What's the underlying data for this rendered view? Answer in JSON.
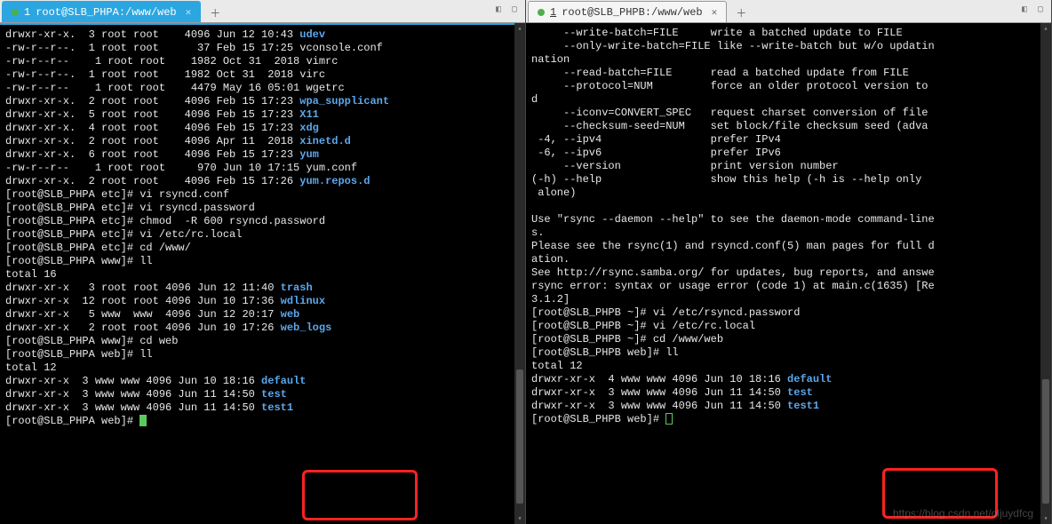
{
  "left": {
    "tab_number": "1",
    "tab_title": "root@SLB_PHPA:/www/web",
    "lines": [
      {
        "perm": "drwxr-xr-x.",
        "n": "3",
        "o": "root",
        "g": "root",
        "sz": "   4096",
        "date": "Jun 12 10:43",
        "name": "udev",
        "dir": true
      },
      {
        "perm": "-rw-r--r--.",
        "n": "1",
        "o": "root",
        "g": "root",
        "sz": "     37",
        "date": "Feb 15 17:25",
        "name": "vconsole.conf"
      },
      {
        "perm": "-rw-r--r--",
        "n": "  1",
        "o": "root",
        "g": "root",
        "sz": "   1982",
        "date": "Oct 31  2018",
        "name": "vimrc"
      },
      {
        "perm": "-rw-r--r--.",
        "n": "1",
        "o": "root",
        "g": "root",
        "sz": "   1982",
        "date": "Oct 31  2018",
        "name": "virc"
      },
      {
        "perm": "-rw-r--r--",
        "n": "  1",
        "o": "root",
        "g": "root",
        "sz": "   4479",
        "date": "May 16 05:01",
        "name": "wgetrc"
      },
      {
        "perm": "drwxr-xr-x.",
        "n": "2",
        "o": "root",
        "g": "root",
        "sz": "   4096",
        "date": "Feb 15 17:23",
        "name": "wpa_supplicant",
        "dir": true
      },
      {
        "perm": "drwxr-xr-x.",
        "n": "5",
        "o": "root",
        "g": "root",
        "sz": "   4096",
        "date": "Feb 15 17:23",
        "name": "X11",
        "dir": true
      },
      {
        "perm": "drwxr-xr-x.",
        "n": "4",
        "o": "root",
        "g": "root",
        "sz": "   4096",
        "date": "Feb 15 17:23",
        "name": "xdg",
        "dir": true
      },
      {
        "perm": "drwxr-xr-x.",
        "n": "2",
        "o": "root",
        "g": "root",
        "sz": "   4096",
        "date": "Apr 11  2018",
        "name": "xinetd.d",
        "dir": true
      },
      {
        "perm": "drwxr-xr-x.",
        "n": "6",
        "o": "root",
        "g": "root",
        "sz": "   4096",
        "date": "Feb 15 17:23",
        "name": "yum",
        "dir": true
      },
      {
        "perm": "-rw-r--r--",
        "n": "  1",
        "o": "root",
        "g": "root",
        "sz": "    970",
        "date": "Jun 10 17:15",
        "name": "yum.conf"
      },
      {
        "perm": "drwxr-xr-x.",
        "n": "2",
        "o": "root",
        "g": "root",
        "sz": "   4096",
        "date": "Feb 15 17:26",
        "name": "yum.repos.d",
        "dir": true
      }
    ],
    "cmds": [
      {
        "p": "[root@SLB_PHPA etc]#",
        "c": "vi rsyncd.conf"
      },
      {
        "p": "[root@SLB_PHPA etc]#",
        "c": "vi rsyncd.password"
      },
      {
        "p": "[root@SLB_PHPA etc]#",
        "c": "chmod  -R 600 rsyncd.password"
      },
      {
        "p": "[root@SLB_PHPA etc]#",
        "c": "vi /etc/rc.local"
      },
      {
        "p": "[root@SLB_PHPA etc]#",
        "c": "cd /www/"
      },
      {
        "p": "[root@SLB_PHPA www]#",
        "c": "ll"
      }
    ],
    "total1": "total 16",
    "lines2": [
      {
        "perm": "drwxr-xr-x",
        "n": " 3",
        "o": "root",
        "g": "root",
        "sz": "4096",
        "date": "Jun 12 11:40",
        "name": "trash",
        "dir": true
      },
      {
        "perm": "drwxr-xr-x",
        "n": "12",
        "o": "root",
        "g": "root",
        "sz": "4096",
        "date": "Jun 10 17:36",
        "name": "wdlinux",
        "dir": true
      },
      {
        "perm": "drwxr-xr-x",
        "n": " 5",
        "o": "www ",
        "g": "www ",
        "sz": "4096",
        "date": "Jun 12 20:17",
        "name": "web",
        "dir": true
      },
      {
        "perm": "drwxr-xr-x",
        "n": " 2",
        "o": "root",
        "g": "root",
        "sz": "4096",
        "date": "Jun 10 17:26",
        "name": "web_logs",
        "dir": true
      }
    ],
    "cmds2": [
      {
        "p": "[root@SLB_PHPA www]#",
        "c": "cd web"
      },
      {
        "p": "[root@SLB_PHPA web]#",
        "c": "ll"
      }
    ],
    "total2": "total 12",
    "lines3": [
      {
        "perm": "drwxr-xr-x",
        "n": "3",
        "o": "www",
        "g": "www",
        "sz": "4096",
        "date": "Jun 10 18:16",
        "name": "default",
        "dir": true
      },
      {
        "perm": "drwxr-xr-x",
        "n": "3",
        "o": "www",
        "g": "www",
        "sz": "4096",
        "date": "Jun 11 14:50",
        "name": "test",
        "dir": true
      },
      {
        "perm": "drwxr-xr-x",
        "n": "3",
        "o": "www",
        "g": "www",
        "sz": "4096",
        "date": "Jun 11 14:50",
        "name": "test1",
        "dir": true
      }
    ],
    "prompt_final": "[root@SLB_PHPA web]# "
  },
  "right": {
    "tab_number": "1",
    "tab_title": "root@SLB_PHPB:/www/web",
    "help": [
      "     --write-batch=FILE     write a batched update to FILE",
      "     --only-write-batch=FILE like --write-batch but w/o updatin",
      "nation",
      "     --read-batch=FILE      read a batched update from FILE",
      "     --protocol=NUM         force an older protocol version to",
      "d",
      "     --iconv=CONVERT_SPEC   request charset conversion of file",
      "     --checksum-seed=NUM    set block/file checksum seed (adva",
      " -4, --ipv4                 prefer IPv4",
      " -6, --ipv6                 prefer IPv6",
      "     --version              print version number",
      "(-h) --help                 show this help (-h is --help only ",
      " alone)",
      "",
      "Use \"rsync --daemon --help\" to see the daemon-mode command-line",
      "s.",
      "Please see the rsync(1) and rsyncd.conf(5) man pages for full d",
      "ation.",
      "See http://rsync.samba.org/ for updates, bug reports, and answe",
      "rsync error: syntax or usage error (code 1) at main.c(1635) [Re",
      "3.1.2]"
    ],
    "cmds": [
      {
        "p": "[root@SLB_PHPB ~]#",
        "c": "vi /etc/rsyncd.password"
      },
      {
        "p": "[root@SLB_PHPB ~]#",
        "c": "vi /etc/rc.local"
      },
      {
        "p": "[root@SLB_PHPB ~]#",
        "c": "cd /www/web"
      },
      {
        "p": "[root@SLB_PHPB web]#",
        "c": "ll"
      }
    ],
    "total": "total 12",
    "lines": [
      {
        "perm": "drwxr-xr-x",
        "n": "4",
        "o": "www",
        "g": "www",
        "sz": "4096",
        "date": "Jun 10 18:16",
        "name": "default",
        "dir": true
      },
      {
        "perm": "drwxr-xr-x",
        "n": "3",
        "o": "www",
        "g": "www",
        "sz": "4096",
        "date": "Jun 11 14:50",
        "name": "test",
        "dir": true
      },
      {
        "perm": "drwxr-xr-x",
        "n": "3",
        "o": "www",
        "g": "www",
        "sz": "4096",
        "date": "Jun 11 14:50",
        "name": "test1",
        "dir": true
      }
    ],
    "prompt_final": "[root@SLB_PHPB web]# ",
    "watermark": "https://blog.csdn.net/oljuydfcg"
  }
}
